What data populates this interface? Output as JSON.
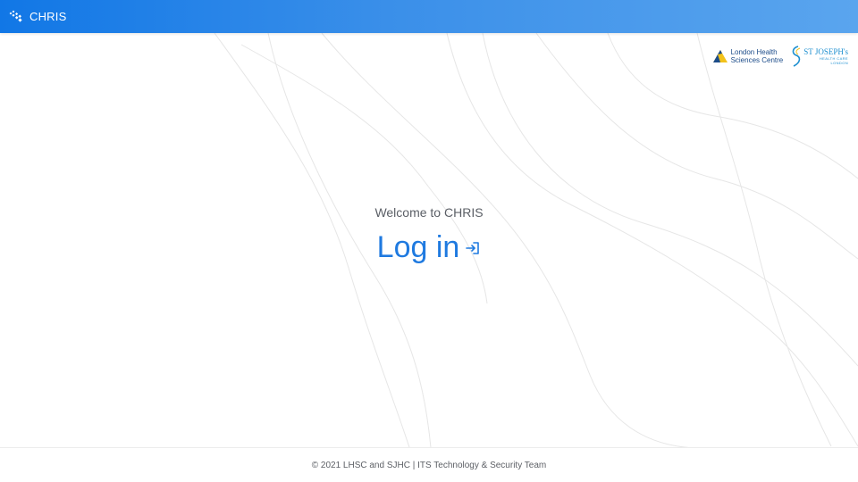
{
  "header": {
    "app_title": "CHRIS",
    "app_icon": "chris-logo-icon",
    "bar_color_start": "#1177e6",
    "bar_color_end": "#5aa5ee"
  },
  "logos": {
    "lhsc": {
      "line1": "London Health",
      "line2": "Sciences Centre"
    },
    "sjhc": {
      "name": "ST JOSEPH's",
      "sub1": "HEALTH CARE",
      "sub2": "LONDON"
    }
  },
  "main": {
    "welcome_text": "Welcome to CHRIS",
    "login_label": "Log in",
    "login_icon": "login-arrow-icon",
    "accent_color": "#1f7ae0"
  },
  "footer": {
    "text": "© 2021 LHSC and SJHC | ITS Technology & Security Team"
  }
}
